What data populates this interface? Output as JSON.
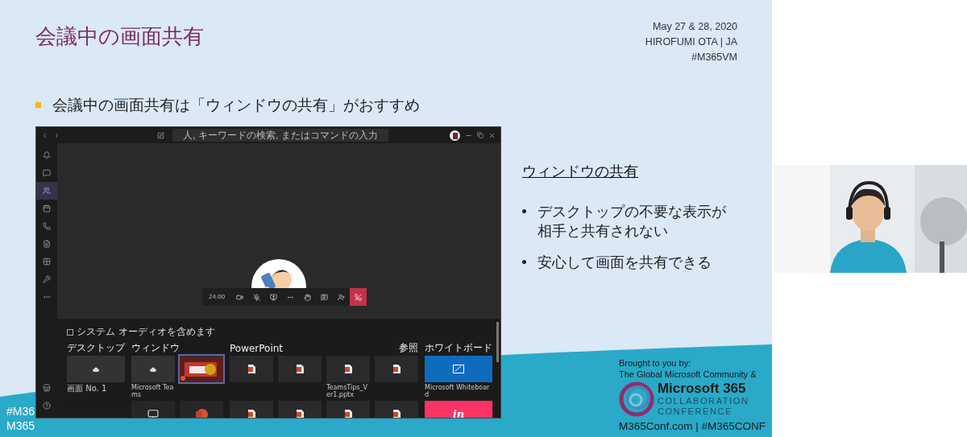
{
  "slide": {
    "title": "会議中の画面共有",
    "meta": [
      "May 27 & 28, 2020",
      "HIROFUMI OTA | JA",
      "#M365VM"
    ],
    "bullet": "会議中の画面共有は「ウィンドウの共有」がおすすめ",
    "side": {
      "heading": "ウィンドウの共有",
      "points": [
        "デスクトップの不要な表示が相手と共有されない",
        "安心して画面を共有できる"
      ]
    },
    "corner_tags": [
      "#M36",
      "M365"
    ],
    "sponsor": {
      "intro": [
        "Brought to you by:",
        "The Global Microsoft Community &"
      ],
      "brand": "Microsoft 365",
      "sub": [
        "COLLABORATION",
        "CONFERENCE"
      ],
      "footer": "M365Conf.com | #M365CONF"
    }
  },
  "teams": {
    "search": {
      "placeholder": "人, キーワードの検索, またはコマンドの入力"
    },
    "sidebar": [
      {
        "selected": false
      },
      {
        "selected": false
      },
      {
        "selected": true
      },
      {
        "selected": false
      },
      {
        "selected": false
      },
      {
        "selected": false
      },
      {
        "selected": false
      },
      {
        "selected": false
      }
    ],
    "call": {
      "timer": "24:00"
    },
    "share": {
      "audio_option": {
        "label": "システム オーディオを含めます",
        "checked": false
      },
      "sections": [
        {
          "title": "デスクトップ",
          "tiles": [
            {
              "kind": "screen",
              "caption": "画面 No. 1",
              "selected": false
            }
          ]
        },
        {
          "title": "ウィンドウ",
          "tiles": [
            {
              "kind": "window",
              "caption": "Microsoft Teams",
              "selected": false
            },
            {
              "kind": "slide",
              "selected": true
            },
            {
              "kind": "monitor",
              "selected": false
            },
            {
              "kind": "ppt",
              "selected": false
            }
          ]
        },
        {
          "title": "PowerPoint",
          "action": "参照",
          "tiles": [
            {
              "kind": "pptx",
              "selected": false
            },
            {
              "kind": "pptx",
              "selected": false
            },
            {
              "kind": "pptx",
              "caption": "TeamsTips_Ver1.pptx",
              "selected": false
            },
            {
              "kind": "pptx",
              "selected": false
            },
            {
              "kind": "pptx",
              "selected": false
            },
            {
              "kind": "pptx",
              "selected": false
            },
            {
              "kind": "pptx",
              "selected": false
            },
            {
              "kind": "pptx",
              "selected": false
            }
          ]
        },
        {
          "title": "ホワイトボード",
          "tiles": [
            {
              "kind": "whiteboard",
              "caption": "Microsoft Whiteboard",
              "selected": false
            },
            {
              "kind": "invision",
              "label": "in",
              "selected": false
            }
          ]
        }
      ]
    }
  }
}
